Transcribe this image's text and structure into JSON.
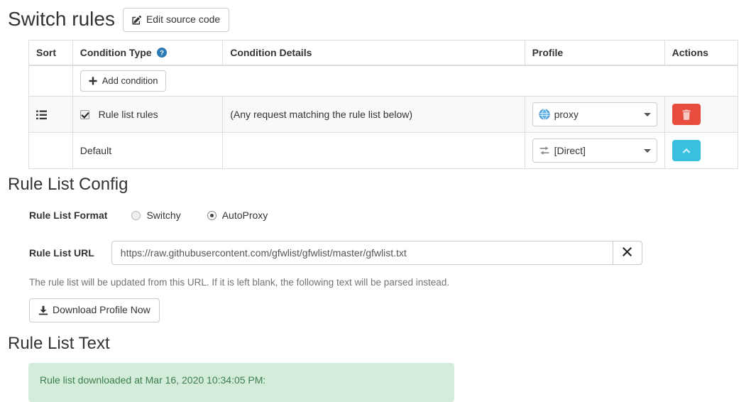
{
  "page": {
    "title": "Switch rules",
    "edit_source_button": "Edit source code",
    "edit_source_icon": "edit-square-icon"
  },
  "rules_table": {
    "columns": [
      {
        "key": "sort",
        "label": "Sort"
      },
      {
        "key": "type",
        "label": "Condition Type",
        "help_icon": "help-circle-icon"
      },
      {
        "key": "details",
        "label": "Condition Details"
      },
      {
        "key": "profile",
        "label": "Profile"
      },
      {
        "key": "actions",
        "label": "Actions"
      }
    ],
    "add_condition_button": "Add condition",
    "add_condition_icon": "plus-icon",
    "rows": [
      {
        "sort_icon": "list-handle-icon",
        "checkbox_checked": true,
        "condition_type": "Rule list rules",
        "condition_details": "(Any request matching the rule list below)",
        "profile": "proxy",
        "profile_icon": "globe-icon",
        "action": "delete",
        "action_icon": "trash-icon",
        "action_color": "#e74c3c"
      },
      {
        "sort_icon": "",
        "checkbox_checked": false,
        "condition_type": "Default",
        "condition_details": "",
        "profile": "[Direct]",
        "profile_icon": "direct-arrows-icon",
        "action": "move-up",
        "action_icon": "chevron-up-icon",
        "action_color": "#39c0e0"
      }
    ]
  },
  "rule_list_config": {
    "heading": "Rule List Config",
    "format_label": "Rule List Format",
    "format_options": [
      {
        "label": "Switchy",
        "selected": false
      },
      {
        "label": "AutoProxy",
        "selected": true
      }
    ],
    "url_label": "Rule List URL",
    "url_value": "https://raw.githubusercontent.com/gfwlist/gfwlist/master/gfwlist.txt",
    "url_placeholder": "",
    "clear_button_icon": "close-x-icon",
    "help_text": "The rule list will be updated from this URL. If it is left blank, the following text will be parsed instead.",
    "download_button": "Download Profile Now",
    "download_icon": "download-icon"
  },
  "rule_list_text": {
    "heading": "Rule List Text",
    "status_message": "Rule list downloaded at Mar 16, 2020 10:34:05 PM:",
    "status_bg": "#d4edda",
    "status_color": "#3b7d4f"
  }
}
